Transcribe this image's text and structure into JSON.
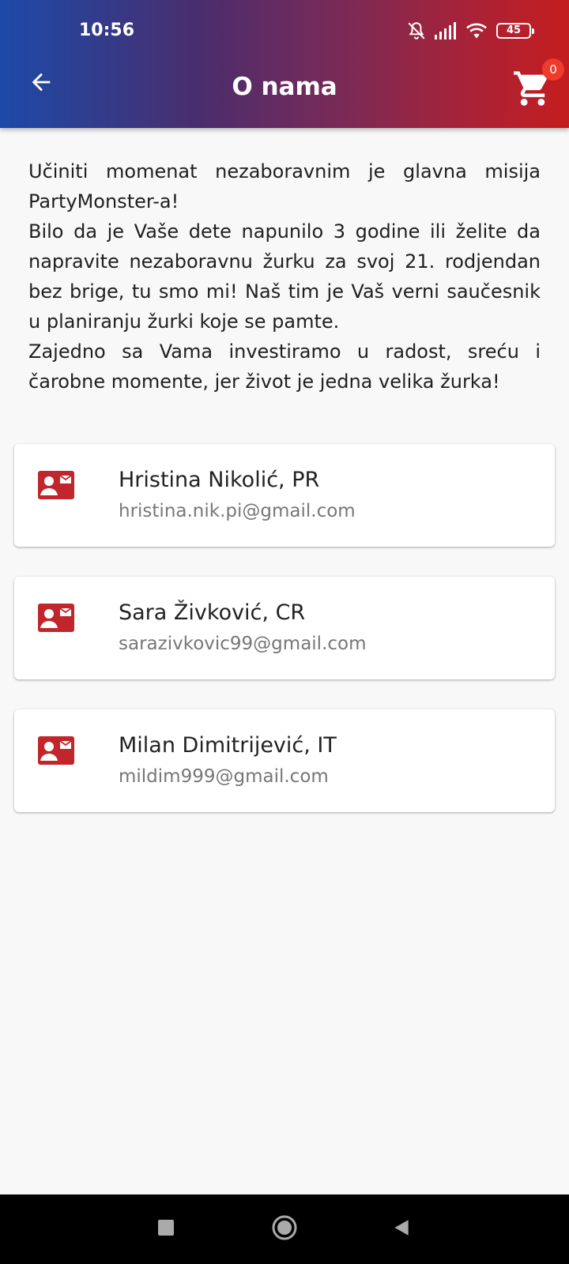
{
  "status": {
    "time": "10:56",
    "battery": "45"
  },
  "appbar": {
    "title": "O nama",
    "cart_count": "0"
  },
  "about": {
    "paragraphs": [
      "Učiniti momenat nezaboravnim je glavna misija PartyMonster-a!",
      "Bilo da je Vaše dete napunilo 3 godine ili želite da napravite nezaboravnu žurku za svoj 21. rodjendan bez brige, tu smo mi! Naš tim je Vaš verni saučesnik u planiranju žurki koje se pamte.",
      "Zajedno sa Vama investiramo u radost, sreću i čarobne momente, jer život je jedna velika žurka!"
    ]
  },
  "contacts": [
    {
      "name": "Hristina Nikolić, PR",
      "email": "hristina.nik.pi@gmail.com"
    },
    {
      "name": "Sara Živković, CR",
      "email": "sarazivkovic99@gmail.com"
    },
    {
      "name": "Milan Dimitrijević, IT",
      "email": "mildim999@gmail.com"
    }
  ],
  "colors": {
    "accent_red": "#c0262b",
    "badge": "#ef3b2c"
  },
  "icons": {
    "back": "arrow-left-icon",
    "cart": "shopping-cart-icon",
    "contact": "contact-mail-icon",
    "nav_recents": "square-icon",
    "nav_home": "circle-icon",
    "nav_back": "triangle-icon"
  }
}
